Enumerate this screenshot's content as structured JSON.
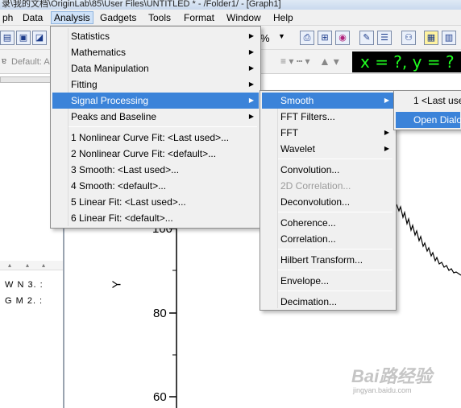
{
  "window": {
    "title": "录\\我的文档\\OriginLab\\85\\User Files\\UNTITLED * - /Folder1/ - [Graph1]"
  },
  "menubar": {
    "items": [
      {
        "label": "ph"
      },
      {
        "label": "Data"
      },
      {
        "label": "Analysis"
      },
      {
        "label": "Gadgets"
      },
      {
        "label": "Tools"
      },
      {
        "label": "Format"
      },
      {
        "label": "Window"
      },
      {
        "label": "Help"
      }
    ]
  },
  "toolbar": {
    "default_font": "Default: A",
    "percent_glyph": "%",
    "xy_readout": "x = ?, y = ?"
  },
  "analysis_menu": {
    "items": [
      {
        "label": "Statistics",
        "has_submenu": true
      },
      {
        "label": "Mathematics",
        "has_submenu": true
      },
      {
        "label": "Data Manipulation",
        "has_submenu": true
      },
      {
        "label": "Fitting",
        "has_submenu": true
      },
      {
        "label": "Signal Processing",
        "has_submenu": true
      },
      {
        "label": "Peaks and Baseline",
        "has_submenu": true
      },
      {
        "label": "1 Nonlinear Curve Fit: <Last used>..."
      },
      {
        "label": "2 Nonlinear Curve Fit: <default>..."
      },
      {
        "label": "3 Smooth: <Last used>..."
      },
      {
        "label": "4 Smooth: <default>..."
      },
      {
        "label": "5 Linear Fit: <Last used>..."
      },
      {
        "label": "6 Linear Fit: <default>..."
      }
    ]
  },
  "signal_menu": {
    "items": [
      {
        "label": "Smooth",
        "has_submenu": true
      },
      {
        "label": "FFT Filters..."
      },
      {
        "label": "FFT",
        "has_submenu": true
      },
      {
        "label": "Wavelet",
        "has_submenu": true
      },
      {
        "label": "Convolution..."
      },
      {
        "label": "2D Correlation...",
        "disabled": true
      },
      {
        "label": "Deconvolution..."
      },
      {
        "label": "Coherence..."
      },
      {
        "label": "Correlation..."
      },
      {
        "label": "Hilbert Transform..."
      },
      {
        "label": "Envelope..."
      },
      {
        "label": "Decimation..."
      }
    ]
  },
  "smooth_menu": {
    "items": [
      {
        "label": "1 <Last use"
      },
      {
        "label": "Open Dialo"
      }
    ]
  },
  "left_panel": {
    "rows": [
      {
        "text": "W N 3. :"
      },
      {
        "text": "G M 2. :"
      }
    ]
  },
  "graph": {
    "y_axis_label": "Y",
    "ticks": [
      "100",
      "80",
      "60"
    ]
  },
  "watermark": {
    "brand": "Bai路经验",
    "site": "jingyan.baidu.com"
  },
  "colors": {
    "highlight": "#3b83d9",
    "readout_bg": "#000000",
    "readout_fg": "#20ff20"
  }
}
